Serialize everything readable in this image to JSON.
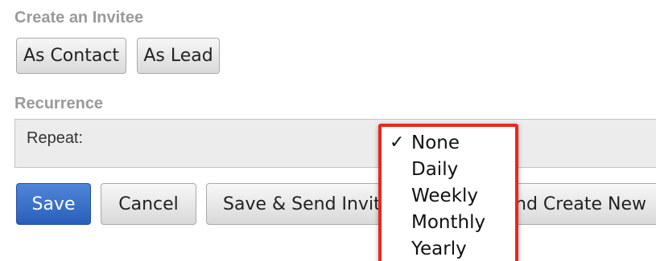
{
  "invitee": {
    "title": "Create an Invitee",
    "as_contact_label": "As Contact",
    "as_lead_label": "As Lead"
  },
  "recurrence": {
    "title": "Recurrence",
    "repeat_label": "Repeat:",
    "selected": "None",
    "options": [
      "None",
      "Daily",
      "Weekly",
      "Monthly",
      "Yearly"
    ],
    "check_glyph": "✓"
  },
  "actions": {
    "save_label": "Save",
    "cancel_label": "Cancel",
    "save_send_label": "Save & Send Invit",
    "save_create_label": "nd Create New"
  },
  "colors": {
    "primary_button": "#2f67c2",
    "highlight_border": "#e8281e",
    "section_title": "#9a9a9a"
  }
}
